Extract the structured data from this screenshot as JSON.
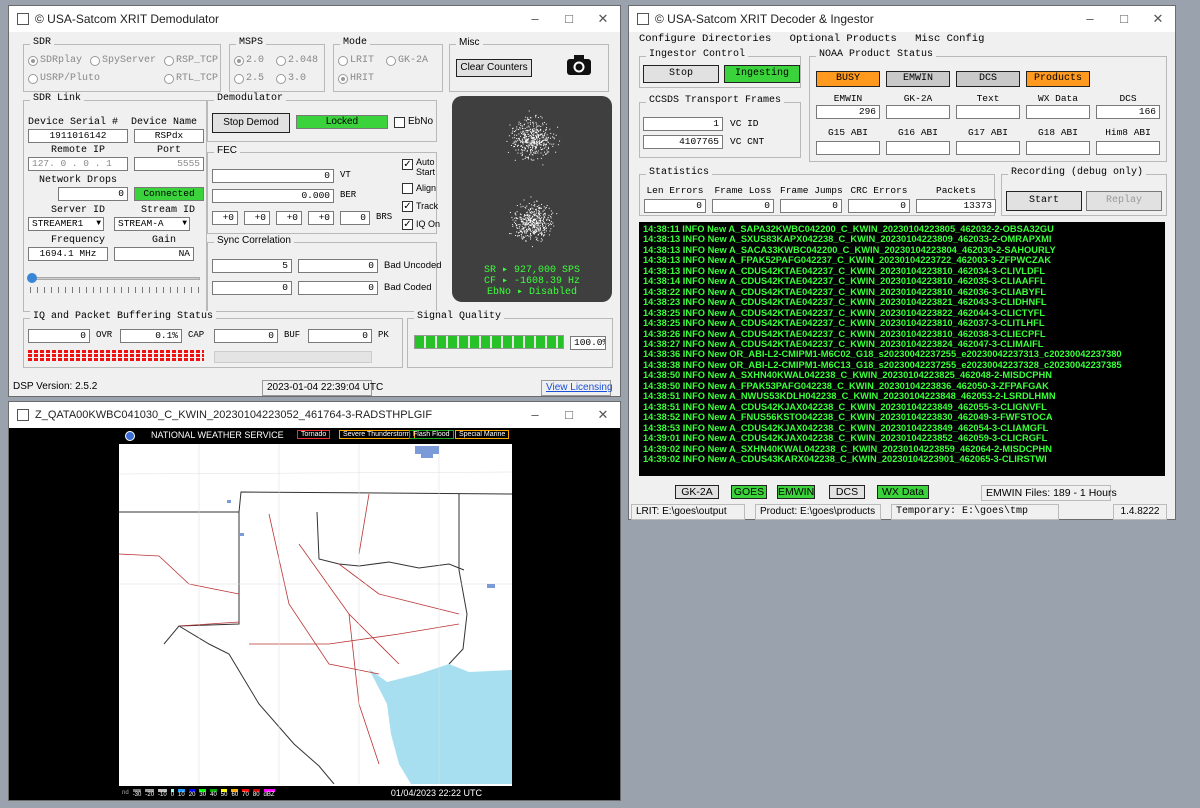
{
  "demod": {
    "title": "© USA-Satcom XRIT Demodulator",
    "sdr": {
      "label": "SDR",
      "options": [
        "SDRplay",
        "SpyServer",
        "RSP_TCP",
        "USRP/Pluto",
        "",
        "RTL_TCP"
      ]
    },
    "msps": {
      "label": "MSPS",
      "options": [
        "2.0",
        "2.048",
        "2.5",
        "3.0"
      ]
    },
    "mode": {
      "label": "Mode",
      "options": [
        "LRIT",
        "GK-2A",
        "HRIT"
      ]
    },
    "misc": {
      "label": "Misc",
      "clear_label": "Clear Counters"
    },
    "sdr_link": {
      "label": "SDR Link",
      "serial_label": "Device Serial #",
      "serial": "1911016142",
      "name_label": "Device Name",
      "name": "RSPdx",
      "ip_label": "Remote IP",
      "ip": "127. 0 . 0 . 1",
      "port_label": "Port",
      "port": "5555",
      "drops_label": "Network Drops",
      "drops": "0",
      "status": "Connected",
      "server_label": "Server ID",
      "server": "STREAMER1",
      "stream_label": "Stream ID",
      "stream": "STREAM-A",
      "freq_label": "Frequency",
      "freq": "1694.1 MHz",
      "gain_label": "Gain",
      "gain": "NA"
    },
    "demodulator": {
      "label": "Demodulator",
      "stop_label": "Stop Demod",
      "lock": "Locked",
      "ebno_label": "EbNo"
    },
    "fec": {
      "label": "FEC",
      "vt": "0",
      "vt_label": "VT",
      "ber": "0.000",
      "ber_label": "BER",
      "brs": [
        "+0",
        "+0",
        "+0",
        "+0",
        "0"
      ],
      "brs_label": "BRS",
      "auto_label": "Auto Start",
      "align_label": "Align",
      "track_label": "Track",
      "iq_label": "IQ On"
    },
    "sync": {
      "label": "Sync Correlation",
      "v1": "5",
      "v2": "0",
      "bad_uncoded_label": "Bad Uncoded",
      "v3": "0",
      "v4": "0",
      "bad_coded_label": "Bad Coded"
    },
    "scope": {
      "sr": "SR ▸ 927,000 SPS",
      "cf": "CF ▸ -1608.39 Hz",
      "ebno": "EbNo ▸ Disabled"
    },
    "iq": {
      "label": "IQ and Packet Buffering Status",
      "v1": "0",
      "ovr_label": "OVR",
      "v2": "0.1%",
      "cap_label": "CAP",
      "v3": "0",
      "buf_label": "BUF",
      "v4": "0",
      "pk_label": "PK"
    },
    "signal": {
      "label": "Signal Quality",
      "value": "100.0%",
      "level": 1.0
    },
    "footer": {
      "version": "DSP Version: 2.5.2",
      "time": "2023-01-04 22:39:04 UTC",
      "license": "View Licensing"
    }
  },
  "decoder": {
    "title": "© USA-Satcom XRIT Decoder & Ingestor",
    "menu": [
      "Configure Directories",
      "Optional Products",
      "Misc Config"
    ],
    "ingestor": {
      "label": "Ingestor Control",
      "stop_label": "Stop",
      "status": "Ingesting"
    },
    "ccsds": {
      "label": "CCSDS Transport Frames",
      "vcid": "1",
      "vcid_label": "VC ID",
      "vccnt": "4107765",
      "vccnt_label": "VC CNT"
    },
    "noaa": {
      "label": "NOAA Product Status",
      "status_btns": [
        "BUSY",
        "EMWIN",
        "DCS",
        "Products"
      ],
      "cols": [
        "EMWIN",
        "GK-2A",
        "Text",
        "WX Data",
        "DCS"
      ],
      "vals": [
        "296",
        "",
        "",
        "",
        "166"
      ],
      "abi": [
        "G15 ABI",
        "G16 ABI",
        "G17 ABI",
        "G18 ABI",
        "Him8 ABI"
      ]
    },
    "stats": {
      "label": "Statistics",
      "cols": [
        "Len Errors",
        "Frame Loss",
        "Frame Jumps",
        "CRC Errors",
        "Packets"
      ],
      "vals": [
        "0",
        "0",
        "0",
        "0",
        "13373"
      ]
    },
    "recording": {
      "label": "Recording (debug only)",
      "start_label": "Start",
      "replay_label": "Replay"
    },
    "log": [
      "14:38:11 INFO  New A_SAPA32KWBC042200_C_KWIN_20230104223805_462032-2-OBSA32GU",
      "14:38:13 INFO  New A_SXUS83KAPX042238_C_KWIN_20230104223809_462033-2-OMRAPXMI",
      "14:38:13 INFO  New A_SACA33KWBC042200_C_KWIN_20230104223804_462030-2-SAHOURLY",
      "14:38:13 INFO  New A_FPAK52PAFG042237_C_KWIN_20230104223722_462003-3-ZFPWCZAK",
      "14:38:13 INFO  New A_CDUS42KTAE042237_C_KWIN_20230104223810_462034-3-CLIVLDFL",
      "14:38:14 INFO  New A_CDUS42KTAE042237_C_KWIN_20230104223810_462035-3-CLIAAFFL",
      "14:38:22 INFO  New A_CDUS42KTAE042237_C_KWIN_20230104223810_462036-3-CLIABYFL",
      "14:38:23 INFO  New A_CDUS42KTAE042237_C_KWIN_20230104223821_462043-3-CLIDHNFL",
      "14:38:25 INFO  New A_CDUS42KTAE042237_C_KWIN_20230104223822_462044-3-CLICTYFL",
      "14:38:25 INFO  New A_CDUS42KTAE042237_C_KWIN_20230104223810_462037-3-CLITLHFL",
      "14:38:26 INFO  New A_CDUS42KTAE042237_C_KWIN_20230104223810_462038-3-CLIECPFL",
      "14:38:27 INFO  New A_CDUS42KTAE042237_C_KWIN_20230104223824_462047-3-CLIMAIFL",
      "14:38:36 INFO  New OR_ABI-L2-CMIPM1-M6C02_G18_s20230042237255_e20230042237313_c20230042237380",
      "14:38:38 INFO  New OR_ABI-L2-CMIPM1-M6C13_G18_s20230042237255_e20230042237328_c20230042237385",
      "14:38:50 INFO  New A_SXHN40KWAL042238_C_KWIN_20230104223825_462048-2-MISDCPHN",
      "14:38:50 INFO  New A_FPAK53PAFG042238_C_KWIN_20230104223836_462050-3-ZFPAFGAK",
      "14:38:51 INFO  New A_NWUS53KDLH042238_C_KWIN_20230104223848_462053-2-LSRDLHMN",
      "14:38:51 INFO  New A_CDUS42KJAX042238_C_KWIN_20230104223849_462055-3-CLIGNVFL",
      "14:38:52 INFO  New A_FNUS56KSTO042238_C_KWIN_20230104223830_462049-3-FWFSTOCA",
      "14:38:53 INFO  New A_CDUS42KJAX042238_C_KWIN_20230104223849_462054-3-CLIAMGFL",
      "14:39:01 INFO  New A_CDUS42KJAX042238_C_KWIN_20230104223852_462059-3-CLICRGFL",
      "14:39:02 INFO  New A_SXHN40KWAL042238_C_KWIN_20230104223859_462064-2-MISDCPHN",
      "14:39:02 INFO  New A_CDUS43KARX042238_C_KWIN_20230104223901_462065-3-CLIRSTWI"
    ],
    "chips": [
      "GK-2A",
      "GOES",
      "EMWIN",
      "DCS",
      "WX Data"
    ],
    "emwin_files": "EMWIN Files: 189 - 1 Hours",
    "footer": {
      "lrit": "LRIT: E:\\goes\\output",
      "product": "Product: E:\\goes\\products",
      "temp": "Temporary: E:\\goes\\tmp",
      "version": "1.4.8222"
    }
  },
  "radar": {
    "title": "Z_QATA00KWBC041030_C_KWIN_20230104223052_461764-3-RADSTHPLGIF",
    "nws": "NATIONAL WEATHER SERVICE",
    "legend": [
      "Tornado",
      "Severe Thunderstorm",
      "Flash Flood",
      "Special Marine"
    ],
    "scale": [
      "-30",
      "-20",
      "-10",
      "0",
      "10",
      "20",
      "30",
      "40",
      "50",
      "60",
      "70",
      "80",
      "dBZ"
    ],
    "scale_prefix": "nd",
    "timestamp": "01/04/2023 22:22 UTC"
  }
}
